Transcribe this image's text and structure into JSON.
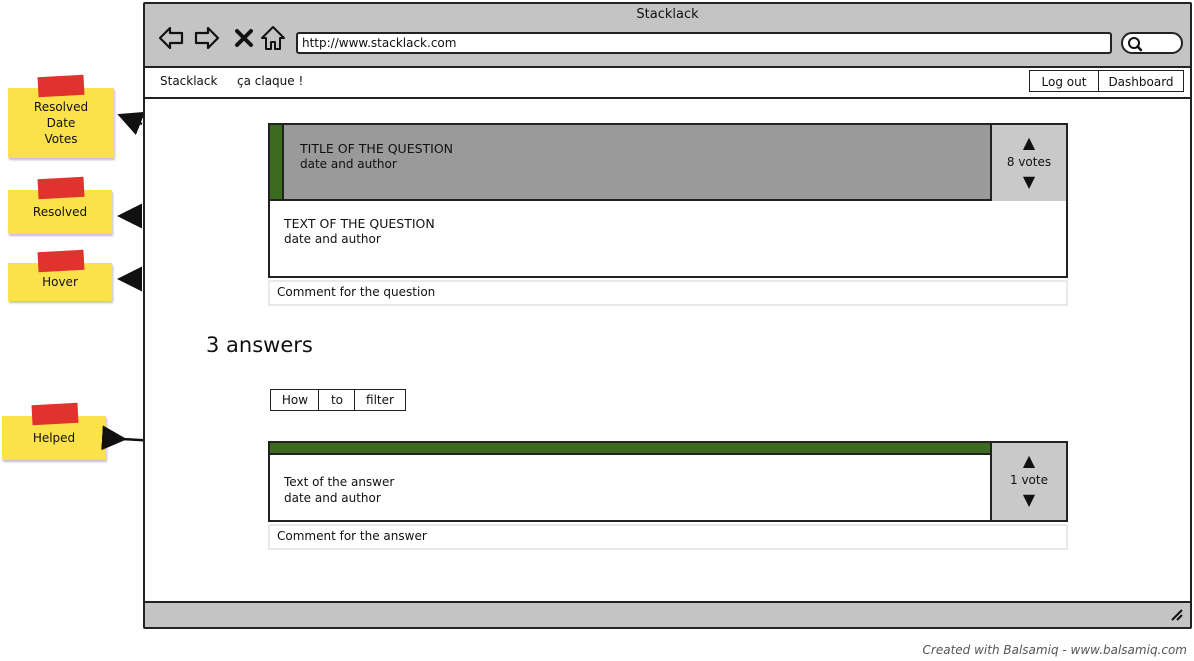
{
  "window": {
    "title": "Stacklack",
    "url": "http://www.stacklack.com"
  },
  "appbar": {
    "brand": "Stacklack",
    "tagline": "ça claque !",
    "logout": "Log out",
    "dashboard": "Dashboard"
  },
  "question": {
    "title": "TITLE OF THE QUESTION",
    "title_meta": "date and author",
    "text": "TEXT OF THE QUESTION",
    "text_meta": "date and author",
    "votes": "8 votes",
    "comment": "Comment for the question"
  },
  "answers": {
    "heading": "3 answers",
    "filter_buttons": [
      "How",
      "to",
      "filter"
    ],
    "items": [
      {
        "text": "Text of the answer",
        "meta": "date and author",
        "votes": "1 vote",
        "comment": "Comment for the answer"
      }
    ]
  },
  "annotations": {
    "resolved_date_votes": [
      "Resolved",
      "Date",
      "Votes"
    ],
    "resolved": "Resolved",
    "hover": "Hover",
    "helped": "Helped"
  },
  "colors": {
    "resolved_green": "#3a6b1e",
    "hover_gray": "#9a9a9a",
    "sticky_yellow": "#fbe24b",
    "tape_red": "#e0332e"
  },
  "footer": "Created with Balsamiq - www.balsamiq.com"
}
